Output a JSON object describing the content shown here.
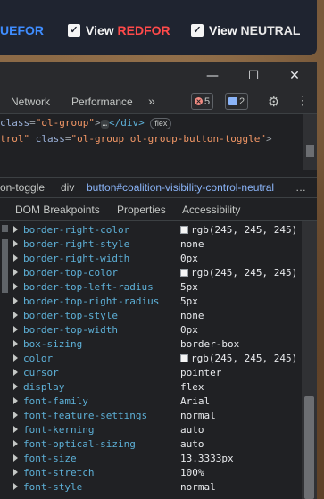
{
  "app_bar": {
    "partial_left_label": "UEFOR",
    "toggles": [
      {
        "prefix": "View",
        "faction": "REDFOR",
        "checked": true
      },
      {
        "prefix": "View",
        "faction": "NEUTRAL",
        "checked": true
      }
    ],
    "colors": {
      "blue": "#3f8dff",
      "red": "#ff4a4a",
      "neutral": "#e8e8e8"
    }
  },
  "window": {
    "minimize_glyph": "—",
    "maximize_glyph": "☐",
    "close_glyph": "✕"
  },
  "devtools_tabs": {
    "items": [
      "Network",
      "Performance"
    ],
    "more_glyph": "»",
    "error_count": "5",
    "message_count": "2",
    "settings_icon": "gear-icon",
    "kebab_icon": "more-vertical-icon"
  },
  "elements_panel": {
    "line1": {
      "attr_name": "class",
      "attr_value": "\"ol-group\"",
      "ellipsis": "…",
      "closing_tag": "</div>",
      "badge": "flex"
    },
    "line2": {
      "prefix": "trol\"",
      "attr_name": "class",
      "attr_value": "\"ol-group ol-group-button-toggle\"",
      "suffix": ">"
    }
  },
  "breadcrumbs": {
    "items": [
      "on-toggle",
      "div",
      "button#coalition-visibility-control-neutral"
    ],
    "more": "…"
  },
  "subtabs": [
    "DOM Breakpoints",
    "Properties",
    "Accessibility"
  ],
  "computed_properties": [
    {
      "name": "border-right-color",
      "value": "rgb(245, 245, 245)",
      "swatch": "#f5f5f5"
    },
    {
      "name": "border-right-style",
      "value": "none"
    },
    {
      "name": "border-right-width",
      "value": "0px"
    },
    {
      "name": "border-top-color",
      "value": "rgb(245, 245, 245)",
      "swatch": "#f5f5f5"
    },
    {
      "name": "border-top-left-radius",
      "value": "5px"
    },
    {
      "name": "border-top-right-radius",
      "value": "5px"
    },
    {
      "name": "border-top-style",
      "value": "none"
    },
    {
      "name": "border-top-width",
      "value": "0px"
    },
    {
      "name": "box-sizing",
      "value": "border-box"
    },
    {
      "name": "color",
      "value": "rgb(245, 245, 245)",
      "swatch": "#f5f5f5"
    },
    {
      "name": "cursor",
      "value": "pointer"
    },
    {
      "name": "display",
      "value": "flex"
    },
    {
      "name": "font-family",
      "value": "Arial"
    },
    {
      "name": "font-feature-settings",
      "value": "normal"
    },
    {
      "name": "font-kerning",
      "value": "auto"
    },
    {
      "name": "font-optical-sizing",
      "value": "auto"
    },
    {
      "name": "font-size",
      "value": "13.3333px"
    },
    {
      "name": "font-stretch",
      "value": "100%"
    },
    {
      "name": "font-style",
      "value": "normal"
    }
  ]
}
